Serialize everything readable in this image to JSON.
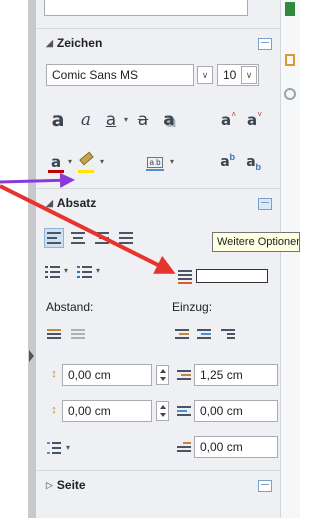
{
  "sections": {
    "zeichen": {
      "title": "Zeichen",
      "font_name": "Comic Sans MS",
      "font_size": "10"
    },
    "absatz": {
      "title": "Absatz",
      "tooltip": "Weitere Optionen",
      "abstand_label": "Abstand:",
      "einzug_label": "Einzug:",
      "spacing_above": "0,00 cm",
      "spacing_below": "0,00 cm",
      "indent_before": "1,25 cm",
      "indent_after": "0,00 cm",
      "indent_first": "0,00 cm"
    },
    "seite": {
      "title": "Seite"
    }
  },
  "colors": {
    "panel_bg": "#eef0f3",
    "arrow_red": "#e8322d",
    "arrow_purple": "#8a3ad9",
    "tooltip_bg": "#ffffe1",
    "highlight_yellow": "#ffe600",
    "font_color_red": "#c00000"
  },
  "icons": [
    "bold-icon",
    "italic-icon",
    "underline-icon",
    "strikethrough-icon",
    "shadow-icon",
    "grow-font-icon",
    "shrink-font-icon",
    "font-color-icon",
    "highlight-icon",
    "char-spacing-icon",
    "superscript-icon",
    "subscript-icon",
    "align-left-icon",
    "align-center-icon",
    "align-right-icon",
    "justify-icon",
    "bullets-icon",
    "numbering-icon",
    "paragraph-background-icon"
  ]
}
